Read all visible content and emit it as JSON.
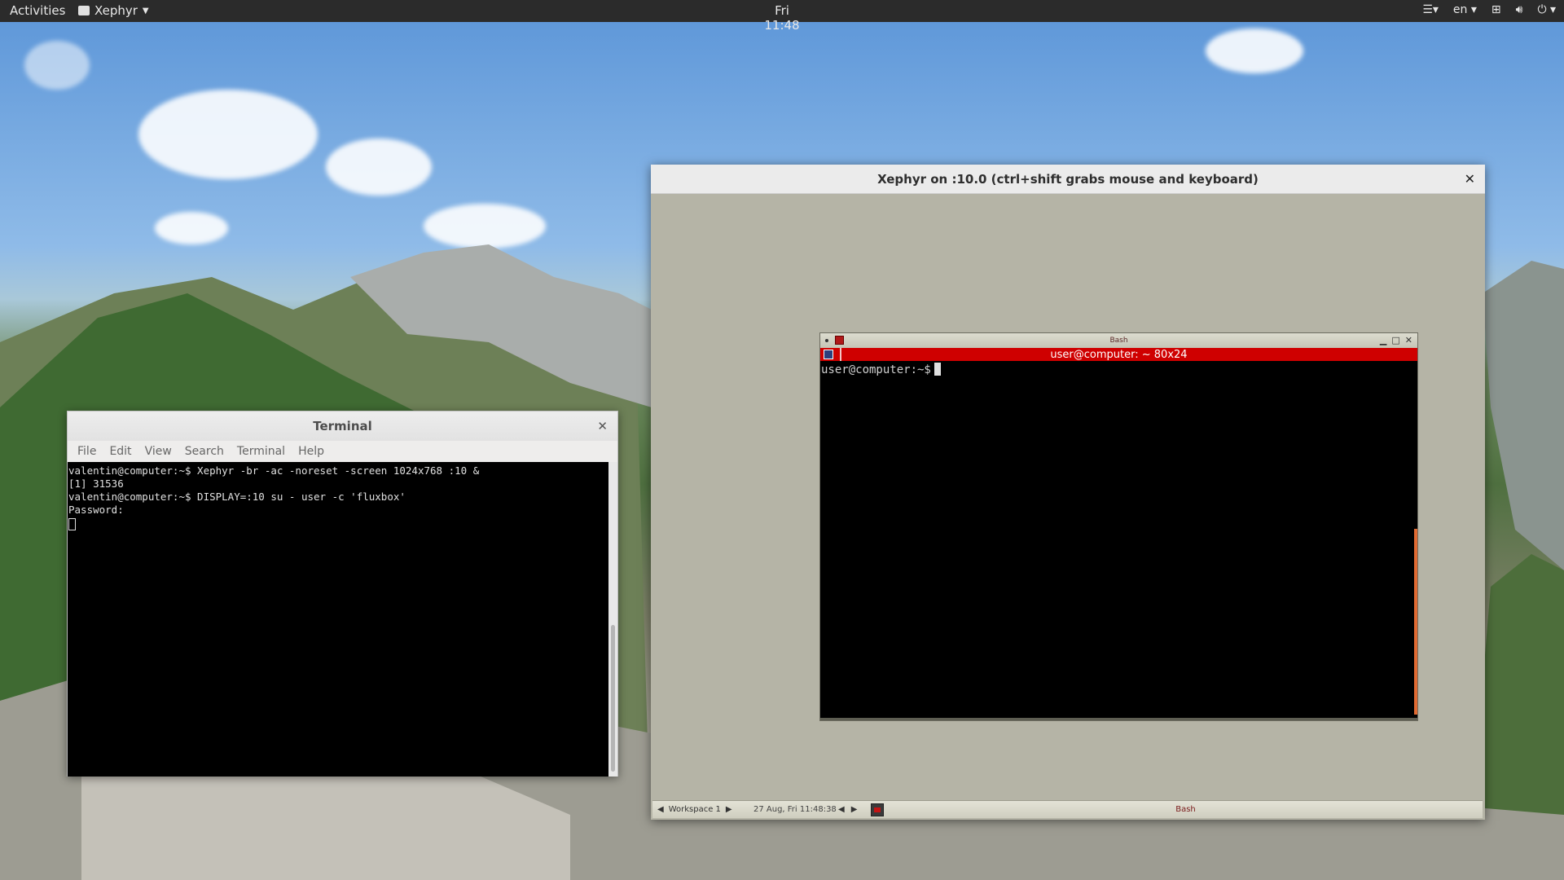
{
  "topbar": {
    "activities": "Activities",
    "app_name": "Xephyr",
    "clock": "Fri 11:48",
    "language": "en"
  },
  "terminal": {
    "title": "Terminal",
    "menu": [
      "File",
      "Edit",
      "View",
      "Search",
      "Terminal",
      "Help"
    ],
    "lines": [
      "valentin@computer:~$ Xephyr -br -ac -noreset -screen 1024x768 :10 &",
      "[1] 31536",
      "valentin@computer:~$ DISPLAY=:10 su - user -c 'fluxbox'",
      "Password:"
    ]
  },
  "xephyr": {
    "title": "Xephyr on :10.0 (ctrl+shift grabs mouse and keyboard)",
    "fluxbox_window": {
      "title": "Bash",
      "tab_title": "user@computer: ~ 80x24",
      "prompt": "user@computer:~$"
    },
    "toolbar": {
      "workspace": "Workspace 1",
      "clock": "27 Aug, Fri 11:48:38",
      "task": "Bash"
    }
  },
  "icons": {
    "close": "close-icon",
    "dropdown": "chevron-down-icon",
    "network": "network-icon",
    "volume": "volume-icon",
    "power": "power-icon",
    "menu": "menu-icon"
  }
}
